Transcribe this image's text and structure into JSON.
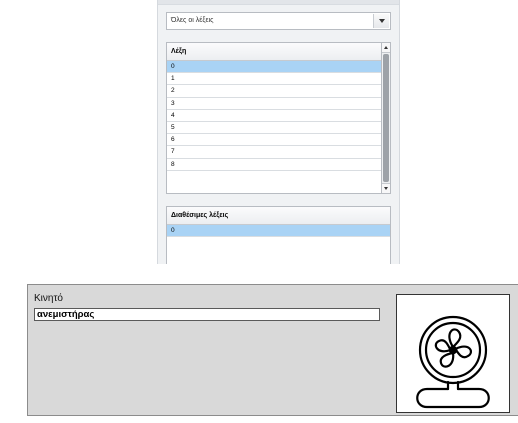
{
  "word_selector": {
    "dropdown_value": "Όλες οι λέξεις",
    "list_header": "Λέξη",
    "items": [
      "0",
      "1",
      "2",
      "3",
      "4",
      "5",
      "6",
      "7",
      "8"
    ],
    "selected_index": 0
  },
  "available_words": {
    "header": "Διαθέσιμες λέξεις",
    "items": [
      "0"
    ]
  },
  "entry": {
    "label": "Κινητό",
    "value": "ανεμιστήρας",
    "image_icon": "fan-icon"
  },
  "colors": {
    "selection": "#a9d3f5",
    "panel_background": "#d9d9d9"
  }
}
